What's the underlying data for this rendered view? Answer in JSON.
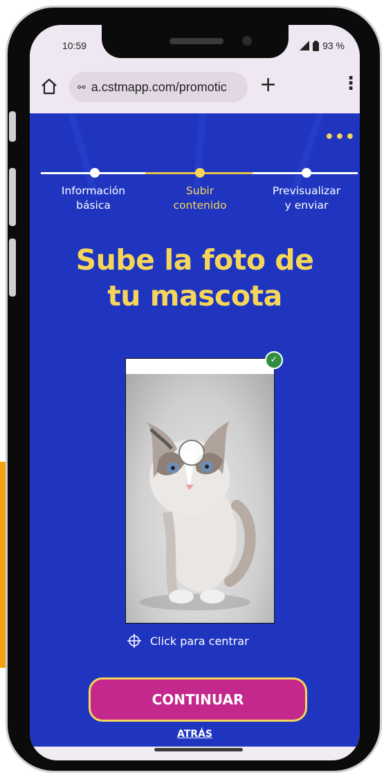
{
  "status_bar": {
    "time": "10:59",
    "battery": "93 %"
  },
  "browser": {
    "url": "a.cstmapp.com/promotic"
  },
  "stepper": {
    "steps": [
      {
        "label": "Información\nbásica",
        "state": "done"
      },
      {
        "label": "Subir\ncontenido",
        "state": "active"
      },
      {
        "label": "Previsualizar\ny enviar",
        "state": "pending"
      }
    ]
  },
  "headline": "Sube la foto de\ntu mascota",
  "photo": {
    "uploaded": true
  },
  "center_hint": "Click para centrar",
  "actions": {
    "continue_label": "CONTINUAR",
    "back_label": "ATRÁS"
  },
  "colors": {
    "background": "#1f35c0",
    "accent_yellow": "#f6d65a",
    "button_magenta": "#c4288c",
    "side_tab_orange": "#f5a10e"
  },
  "icons": [
    "home-icon",
    "site-settings-icon",
    "new-tab-icon",
    "browser-menu-icon",
    "more-options-icon",
    "check-icon",
    "crosshair-icon"
  ]
}
